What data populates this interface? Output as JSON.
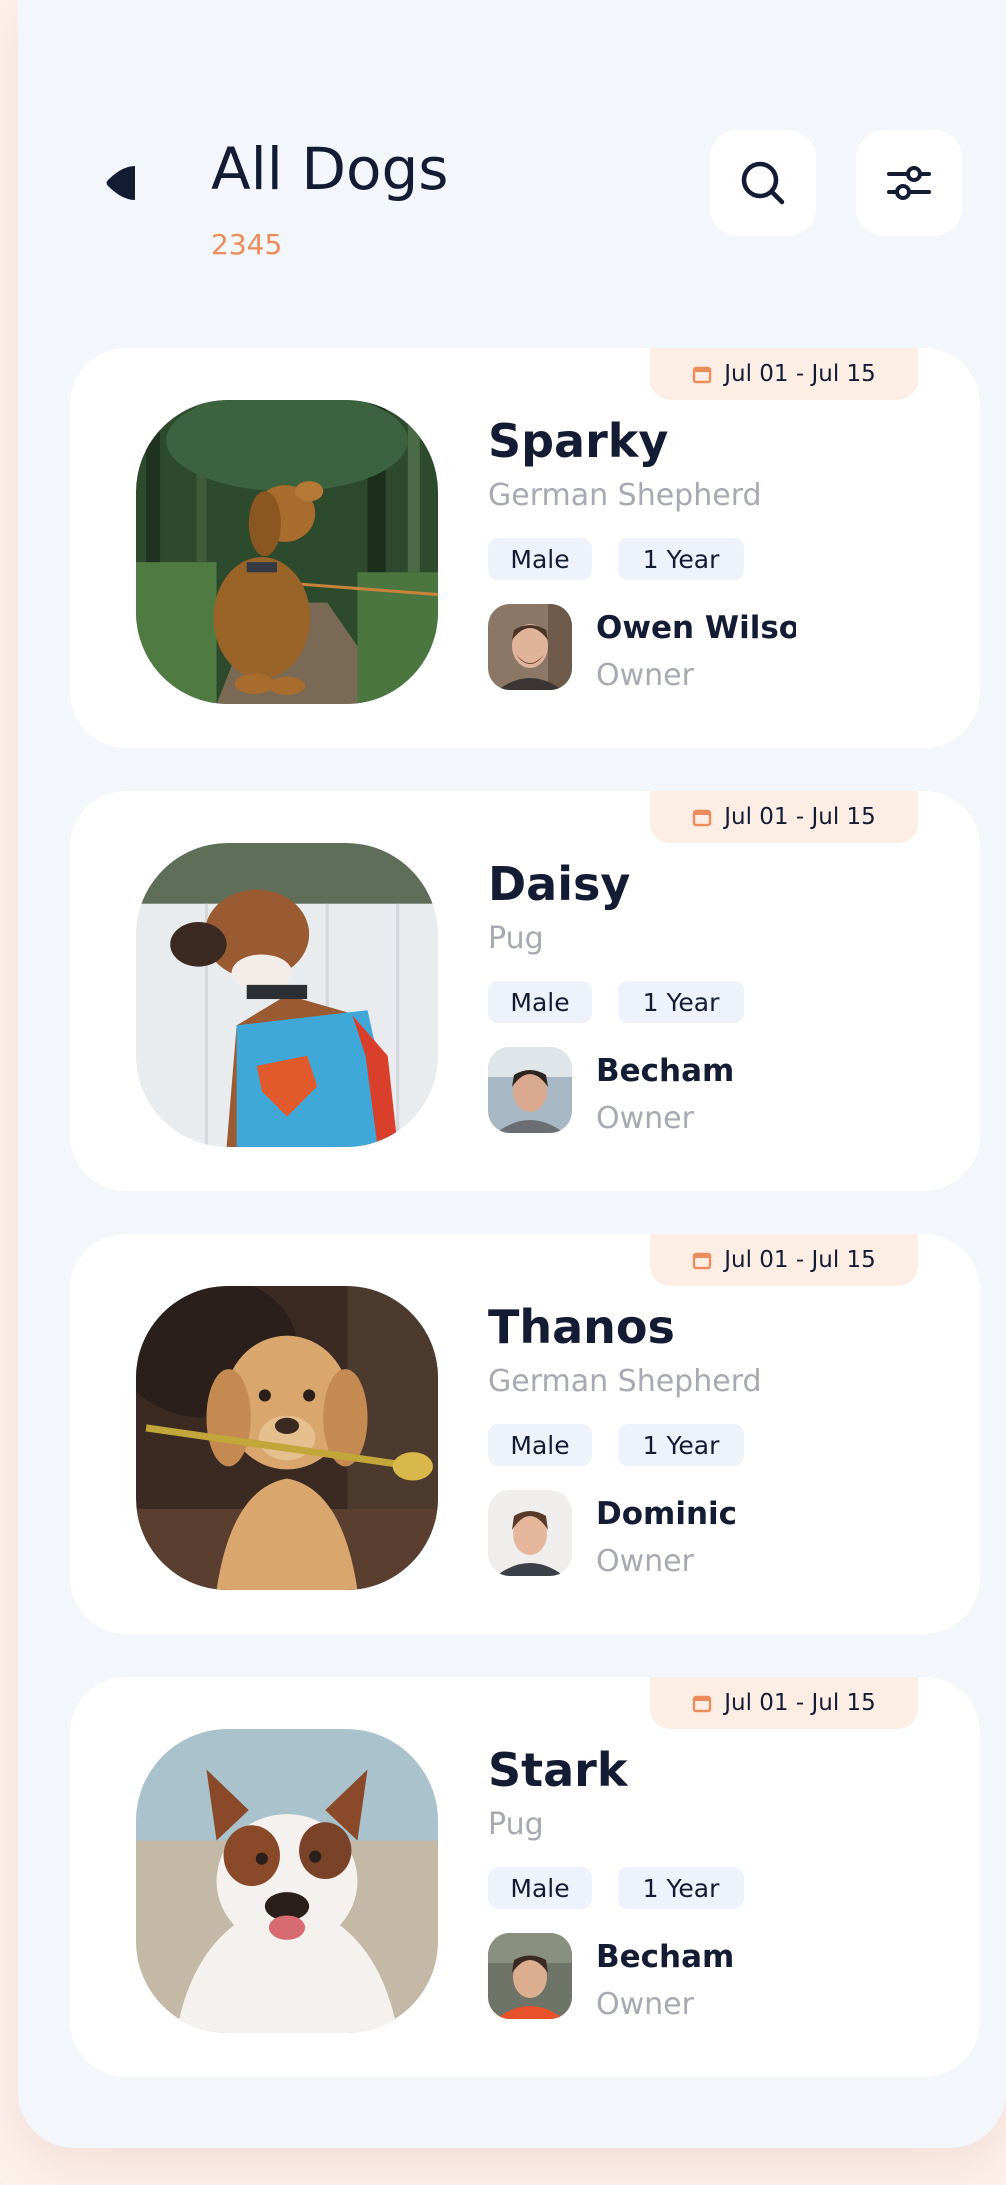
{
  "header": {
    "title": "All Dogs",
    "count": "2345",
    "back_icon": "back-arrow-icon",
    "search_icon": "search-icon",
    "filter_icon": "filter-sliders-icon"
  },
  "colors": {
    "accent": "#ea8c5b",
    "text": "#131c33",
    "muted": "#a7a9b3",
    "background": "#f3f6fa",
    "tag_bg": "#eef2fa",
    "date_bg": "#fdeee5"
  },
  "dogs": [
    {
      "date_range": "Jul 01 - Jul 15",
      "name": "Sparky",
      "breed": "German Shepherd",
      "sex": "Male",
      "age": "1 Year",
      "owner": {
        "name": "Owen Wilson",
        "role": "Owner"
      }
    },
    {
      "date_range": "Jul 01 - Jul 15",
      "name": "Daisy",
      "breed": "Pug",
      "sex": "Male",
      "age": "1 Year",
      "owner": {
        "name": "Becham",
        "role": "Owner"
      }
    },
    {
      "date_range": "Jul 01 - Jul 15",
      "name": "Thanos",
      "breed": "German Shepherd",
      "sex": "Male",
      "age": "1 Year",
      "owner": {
        "name": "Dominic",
        "role": "Owner"
      }
    },
    {
      "date_range": "Jul 01 - Jul 15",
      "name": "Stark",
      "breed": "Pug",
      "sex": "Male",
      "age": "1 Year",
      "owner": {
        "name": "Becham",
        "role": "Owner"
      }
    }
  ]
}
